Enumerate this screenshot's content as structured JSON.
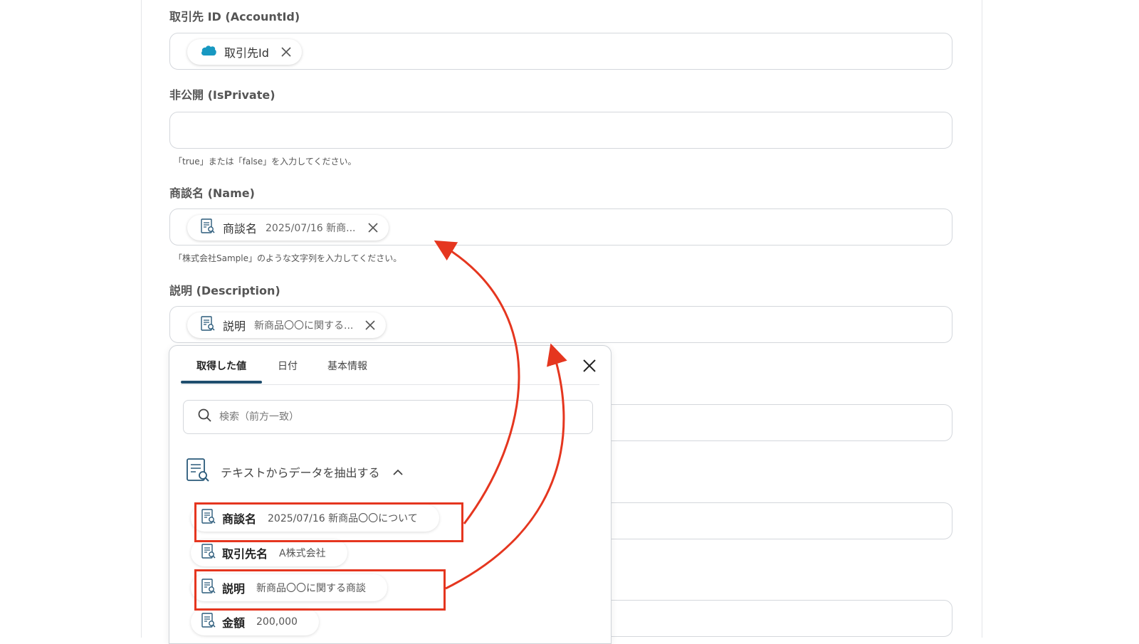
{
  "fields": [
    {
      "label": "取引先 ID (AccountId)",
      "chip": {
        "title": "取引先Id",
        "value": ""
      }
    },
    {
      "label": "非公開 (IsPrivate)",
      "hint": "「true」または「false」を入力してください。"
    },
    {
      "label": "商談名 (Name)",
      "chip": {
        "title": "商談名",
        "value": "2025/07/16 新商..."
      },
      "hint": "「株式会社Sample」のような文字列を入力してください。"
    },
    {
      "label": "説明 (Description)",
      "chip": {
        "title": "説明",
        "value": "新商品〇〇に関する..."
      }
    }
  ],
  "popup": {
    "tabs": [
      "取得した値",
      "日付",
      "基本情報"
    ],
    "active_tab": 0,
    "search_placeholder": "検索（前方一致）",
    "group_title": "テキストからデータを抽出する",
    "items": [
      {
        "title": "商談名",
        "value": "2025/07/16 新商品〇〇について"
      },
      {
        "title": "取引先名",
        "value": "A株式会社"
      },
      {
        "title": "説明",
        "value": "新商品〇〇に関する商談"
      },
      {
        "title": "金額",
        "value": "200,000"
      }
    ]
  },
  "colors": {
    "accent": "#1f4e6e",
    "highlight": "#e5361f",
    "salesforce": "#1798c1"
  },
  "icons": {
    "salesforce": "salesforce-cloud-icon",
    "extract": "document-search-icon",
    "close": "close-icon",
    "search": "search-icon",
    "collapse": "chevron-up-icon"
  }
}
